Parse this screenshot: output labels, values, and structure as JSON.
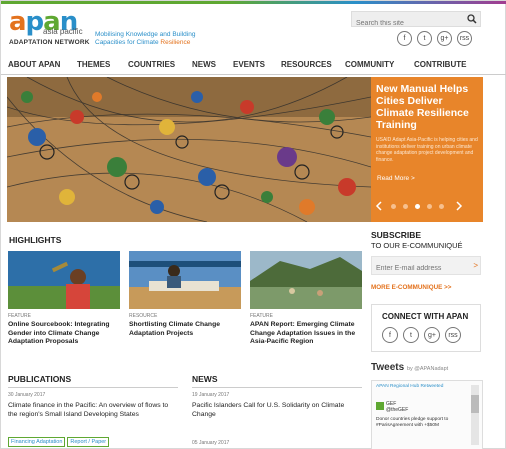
{
  "header": {
    "logo": {
      "asia_pacific": "asia pacific",
      "network": "ADAPTATION NETWORK"
    },
    "tagline_1": "Mobilising Knowledge and Building",
    "tagline_2": "Capacities for Climate",
    "tagline_3": "Resilience",
    "search_placeholder": "Search this site",
    "social": [
      "f",
      "t",
      "g+",
      "rss"
    ]
  },
  "nav": [
    "ABOUT APAN",
    "THEMES",
    "COUNTRIES",
    "NEWS",
    "EVENTS",
    "RESOURCES",
    "COMMUNITY",
    "CONTRIBUTE"
  ],
  "hero": {
    "title": "New Manual Helps Cities Deliver Climate Resilience Training",
    "body": "USAID Adapt Asia-Pacific is helping cities and institutions deliver training on urban climate change adaptation project development and finance.",
    "more": "Read More >",
    "slide_count": 5,
    "active_slide": 3
  },
  "highlights": {
    "title": "HIGHLIGHTS",
    "items": [
      {
        "tag": "FEATURE",
        "title": "Online Sourcebook: Integrating Gender into Climate Change Adaptation Proposals"
      },
      {
        "tag": "RESOURCE",
        "title": "Shortlisting Climate Change Adaptation Projects"
      },
      {
        "tag": "FEATURE",
        "title": "APAN Report: Emerging Climate Change Adaptation Issues in the Asia-Pacific Region"
      }
    ]
  },
  "subscribe": {
    "title": "SUBSCRIBE",
    "subtitle": "TO OUR E-COMMUNIQUÉ",
    "placeholder": "Enter E-mail address",
    "go": ">",
    "more": "MORE E-COMMUNIQUE >>"
  },
  "connect": {
    "title": "CONNECT WITH APAN",
    "icons": [
      "f",
      "t",
      "g+",
      "rss"
    ]
  },
  "tweets": {
    "title": "Tweets",
    "by": "by @APANadapt",
    "retweet": "APAN Regional Hub Retweeted",
    "name": "GEF",
    "handle": "@theGEF",
    "body": "Donor countries pledge support to #ParisAgreement with +$50M"
  },
  "publications": {
    "title": "PUBLICATIONS",
    "date": "30 January 2017",
    "text": "Climate finance in the Pacific: An overview of flows to the region's Small Island Developing States",
    "tags": [
      "Financing Adaptation",
      "Report / Paper"
    ]
  },
  "news": {
    "title": "NEWS",
    "items": [
      {
        "date": "19 January 2017",
        "text": "Pacific Islanders Call for U.S. Solidarity on Climate Change"
      },
      {
        "date": "05 January 2017",
        "text": ""
      }
    ]
  }
}
